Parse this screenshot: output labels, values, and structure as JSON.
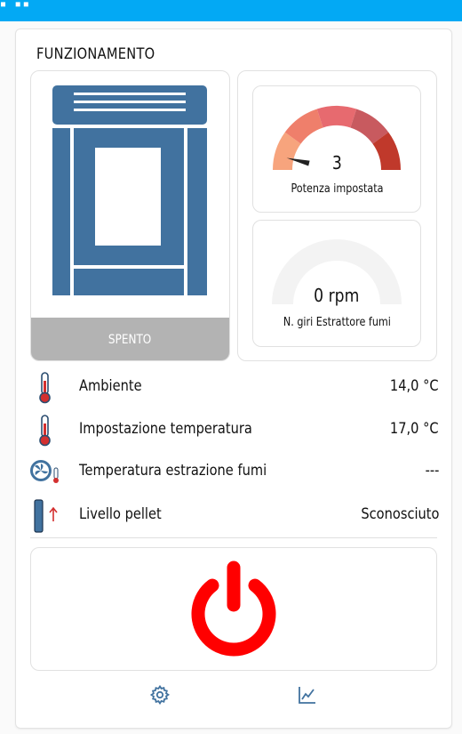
{
  "colors": {
    "accent": "#03a9f4",
    "stove": "#41729f",
    "power": "#ff0000",
    "thermo": "#d32f2f"
  },
  "header": {
    "title": "FUNZIONAMENTO"
  },
  "stove": {
    "status": "SPENTO"
  },
  "gauges": {
    "power": {
      "value": 3,
      "value_text": "3",
      "min": 1,
      "max": 5,
      "label": "Potenza impostata"
    },
    "fan": {
      "value_text": "0 rpm",
      "label": "N. giri Estrattore fumi"
    }
  },
  "rows": [
    {
      "icon": "thermometer-icon",
      "label": "Ambiente",
      "value": "14,0 °C"
    },
    {
      "icon": "thermometer-icon",
      "label": "Impostazione temperatura",
      "value": "17,0 °C"
    },
    {
      "icon": "fan-thermometer-icon",
      "label": "Temperatura estrazione fumi",
      "value": "---"
    },
    {
      "icon": "pellet-level-icon",
      "label": "Livello pellet",
      "value": "Sconosciuto"
    }
  ],
  "actions": {
    "power": "power-icon",
    "settings": "gear-icon",
    "chart": "chart-line-icon"
  }
}
